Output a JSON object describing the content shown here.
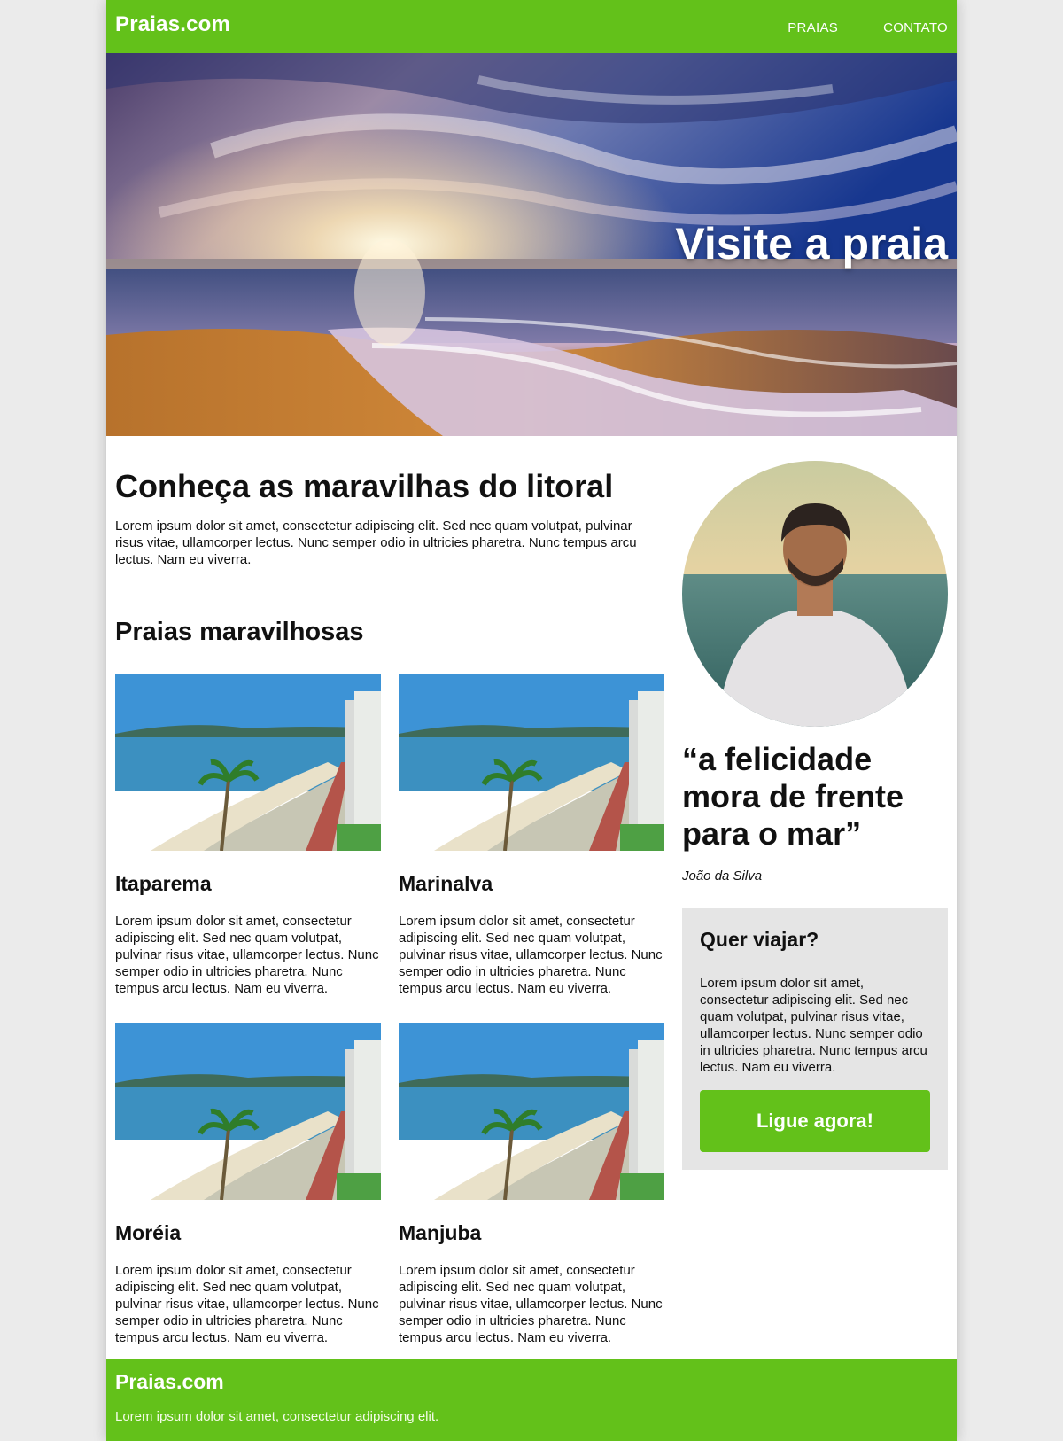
{
  "header": {
    "brand": "Praias.com",
    "nav": [
      {
        "label": "PRAIAS"
      },
      {
        "label": "CONTATO"
      }
    ]
  },
  "hero": {
    "title": "Visite a praia",
    "image": "beach-sunset-image"
  },
  "intro": {
    "title": "Conheça as maravilhas do litoral",
    "text": "Lorem ipsum dolor sit amet, consectetur adipiscing elit. Sed nec quam volutpat, pulvinar risus vitae, ullamcorper lectus. Nunc semper odio in ultricies pharetra. Nunc tempus arcu lectus. Nam eu viverra."
  },
  "beaches": {
    "title": "Praias maravilhosas",
    "items": [
      {
        "name": "Itaparema",
        "text": "Lorem ipsum dolor sit amet, consectetur adipiscing elit. Sed nec quam volutpat, pulvinar risus vitae, ullamcorper lectus. Nunc semper odio in ultricies pharetra. Nunc tempus arcu lectus. Nam eu viverra."
      },
      {
        "name": "Marinalva",
        "text": "Lorem ipsum dolor sit amet, consectetur adipiscing elit. Sed nec quam volutpat, pulvinar risus vitae, ullamcorper lectus. Nunc semper odio in ultricies pharetra. Nunc tempus arcu lectus. Nam eu viverra."
      },
      {
        "name": "Moréia",
        "text": "Lorem ipsum dolor sit amet, consectetur adipiscing elit. Sed nec quam volutpat, pulvinar risus vitae, ullamcorper lectus. Nunc semper odio in ultricies pharetra. Nunc tempus arcu lectus. Nam eu viverra."
      },
      {
        "name": "Manjuba",
        "text": "Lorem ipsum dolor sit amet, consectetur adipiscing elit. Sed nec quam volutpat, pulvinar risus vitae, ullamcorper lectus. Nunc semper odio in ultricies pharetra. Nunc tempus arcu lectus. Nam eu viverra."
      }
    ]
  },
  "sidebar": {
    "quote": "“a felicidade mora de frente para o mar”",
    "author": "João da Silva",
    "cta": {
      "title": "Quer viajar?",
      "text": "Lorem ipsum dolor sit amet, consectetur adipiscing elit. Sed nec quam volutpat, pulvinar risus vitae, ullamcorper lectus. Nunc semper odio in ultricies pharetra. Nunc tempus arcu lectus. Nam eu viverra.",
      "button": "Ligue agora!"
    }
  },
  "footer": {
    "brand": "Praias.com",
    "text": "Lorem ipsum dolor sit amet, consectetur adipiscing elit."
  },
  "colors": {
    "accent": "#63c11a",
    "page_background": "#ebebeb",
    "cta_background": "#e5e5e5"
  }
}
